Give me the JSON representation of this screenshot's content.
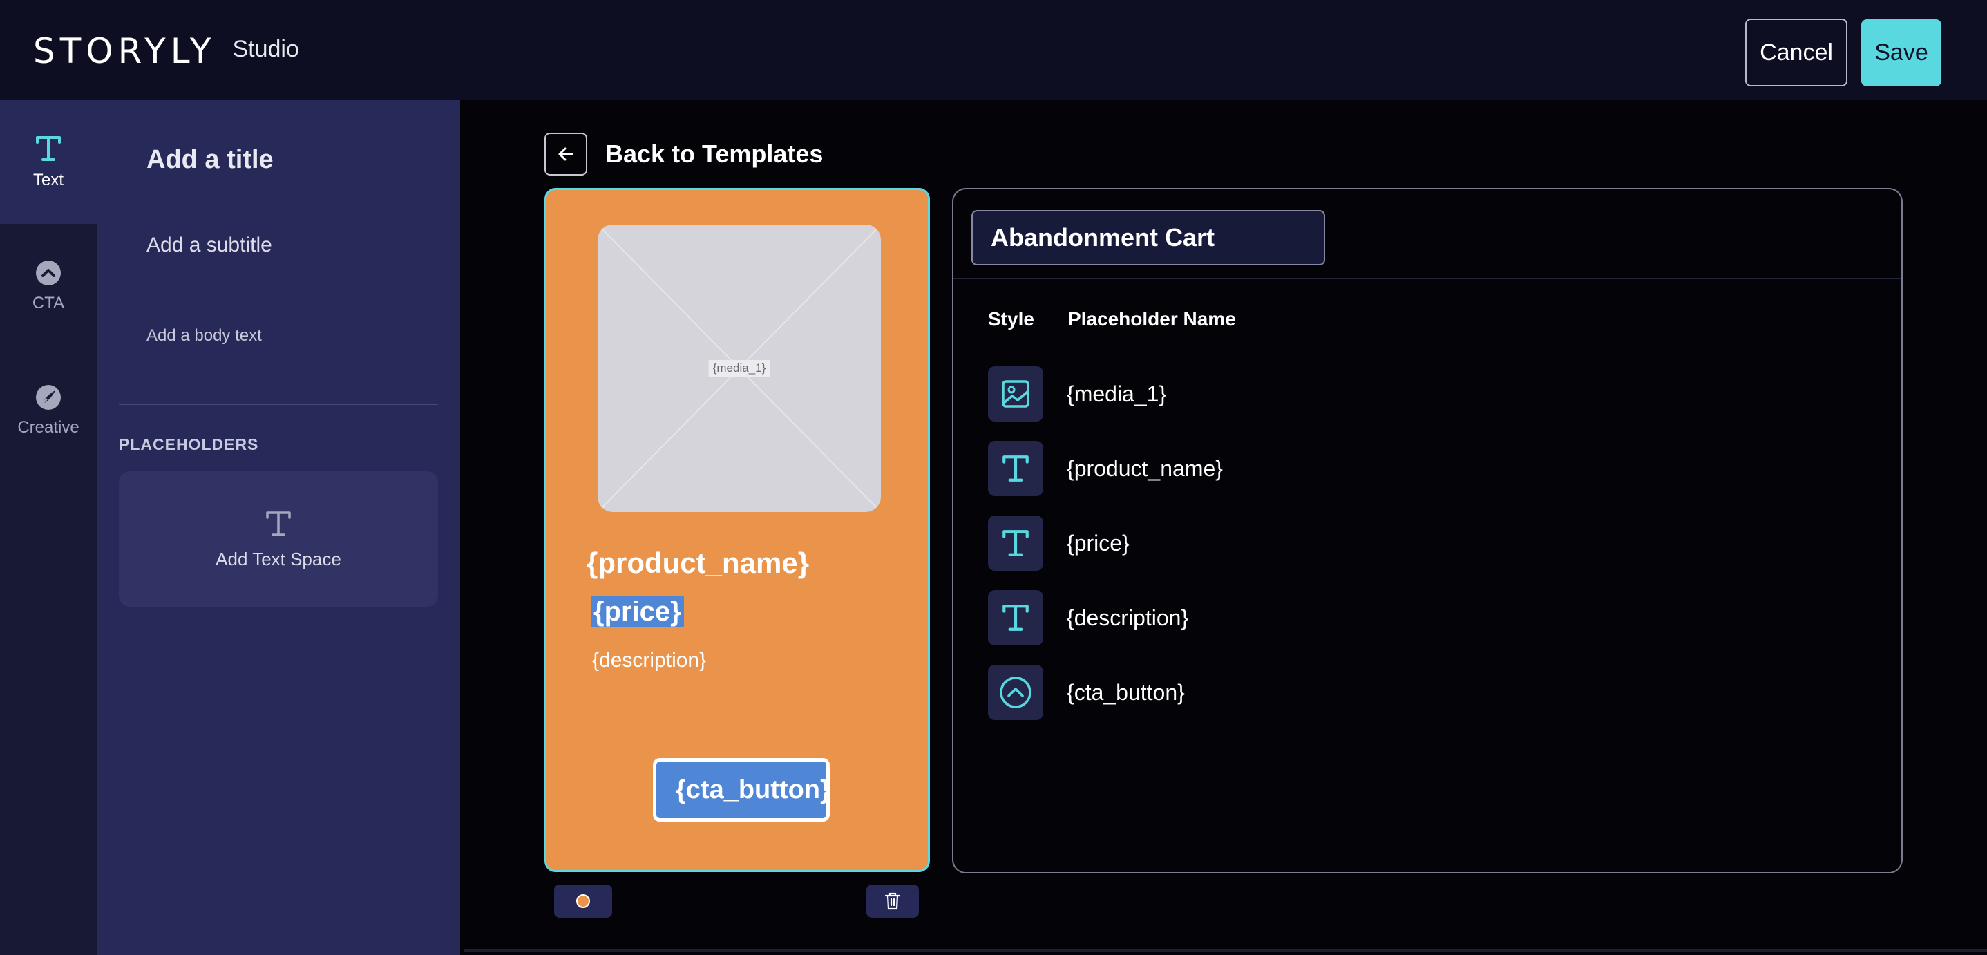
{
  "header": {
    "logo_text": "STORYLY",
    "logo_suffix": "Studio",
    "cancel_label": "Cancel",
    "save_label": "Save"
  },
  "rail": {
    "items": [
      {
        "label": "Text",
        "icon": "text-icon",
        "active": true
      },
      {
        "label": "CTA",
        "icon": "cta-icon",
        "active": false
      },
      {
        "label": "Creative",
        "icon": "creative-icon",
        "active": false
      }
    ]
  },
  "text_panel": {
    "title_option": "Add a title",
    "subtitle_option": "Add a subtitle",
    "body_option": "Add a body text",
    "placeholders_heading": "PLACEHOLDERS",
    "add_text_space_label": "Add Text Space"
  },
  "main": {
    "back_label": "Back to Templates"
  },
  "story": {
    "media_placeholder": "{media_1}",
    "product_name": "{product_name}",
    "price": "{price}",
    "description": "{description}",
    "cta_button": "{cta_button}",
    "background_color": "#ea934a"
  },
  "template": {
    "name": "Abandonment Cart",
    "col_style": "Style",
    "col_placeholder": "Placeholder Name",
    "rows": [
      {
        "icon": "image-icon",
        "name": "{media_1}"
      },
      {
        "icon": "text-icon",
        "name": "{product_name}"
      },
      {
        "icon": "text-icon",
        "name": "{price}"
      },
      {
        "icon": "text-icon",
        "name": "{description}"
      },
      {
        "icon": "cta-icon",
        "name": "{cta_button}"
      }
    ]
  },
  "colors": {
    "accent": "#5ad8e0",
    "story_bg": "#ea934a",
    "highlight": "#4f86d6"
  }
}
